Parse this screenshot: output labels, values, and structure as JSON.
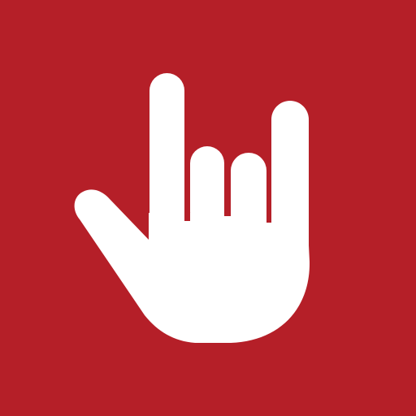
{
  "icon": {
    "name": "rock-on-hand-icon",
    "background_color": "#B51F28",
    "glyph_color": "#FFFFFF"
  }
}
